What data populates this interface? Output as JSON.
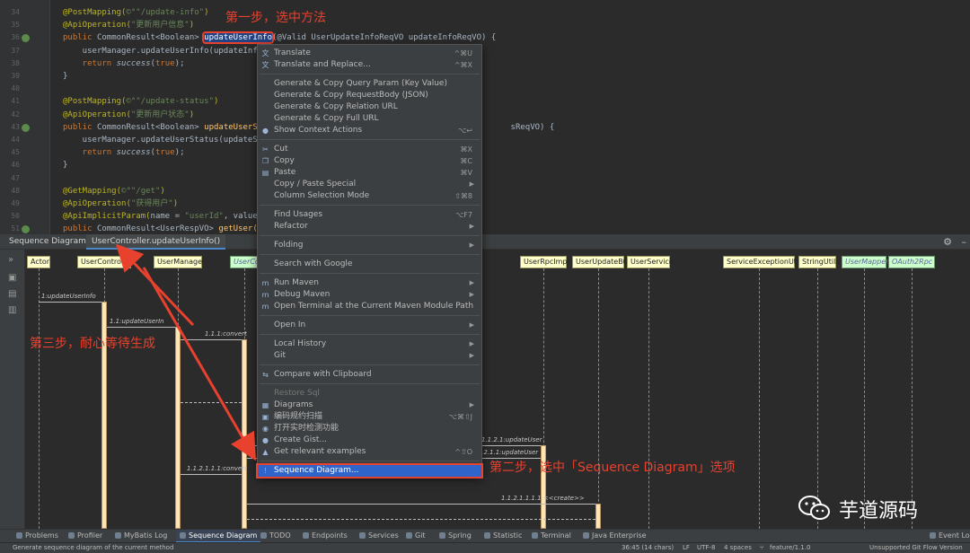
{
  "editor": {
    "lines": [
      {
        "n": "34",
        "parts": [
          [
            "ann",
            "@PostMapping("
          ],
          [
            "str",
            "©°\"/update-info\""
          ],
          [
            "ann",
            ")"
          ]
        ]
      },
      {
        "n": "35",
        "parts": [
          [
            "ann",
            "@ApiOperation("
          ],
          [
            "str",
            "\"更新用户信息\""
          ],
          [
            "ann",
            ")"
          ]
        ]
      },
      {
        "n": "36",
        "parts": [
          [
            "kw",
            "public "
          ],
          [
            "",
            "CommonResult<Boolean> "
          ],
          [
            "hl",
            "updateUserInfo"
          ],
          [
            "",
            "(@Valid UserUpdateInfoReqVO updateInfoReqVO) {"
          ]
        ]
      },
      {
        "n": "37",
        "parts": [
          [
            "",
            "    userManager.updateUserInfo(updateInf"
          ]
        ]
      },
      {
        "n": "38",
        "parts": [
          [
            "kw",
            "    return "
          ],
          [
            "it",
            "success"
          ],
          [
            "",
            "("
          ],
          [
            "kw",
            "true"
          ],
          [
            "",
            ");"
          ]
        ]
      },
      {
        "n": "39",
        "parts": [
          [
            "",
            "}"
          ]
        ]
      },
      {
        "n": "40",
        "parts": [
          [
            "",
            ""
          ]
        ]
      },
      {
        "n": "41",
        "parts": [
          [
            "ann",
            "@PostMapping("
          ],
          [
            "str",
            "©°\"/update-status\""
          ],
          [
            "ann",
            ")"
          ]
        ]
      },
      {
        "n": "42",
        "parts": [
          [
            "ann",
            "@ApiOperation("
          ],
          [
            "str",
            "\"更新用户状态\""
          ],
          [
            "ann",
            ")"
          ]
        ]
      },
      {
        "n": "43",
        "parts": [
          [
            "kw",
            "public "
          ],
          [
            "",
            "CommonResult<Boolean> "
          ],
          [
            "fn",
            "updateUserS"
          ],
          [
            "",
            "                                                    sReqVO) {"
          ]
        ]
      },
      {
        "n": "44",
        "parts": [
          [
            "",
            "    userManager.updateUserStatus(updateS"
          ]
        ]
      },
      {
        "n": "45",
        "parts": [
          [
            "kw",
            "    return "
          ],
          [
            "it",
            "success"
          ],
          [
            "",
            "("
          ],
          [
            "kw",
            "true"
          ],
          [
            "",
            ");"
          ]
        ]
      },
      {
        "n": "46",
        "parts": [
          [
            "",
            "}"
          ]
        ]
      },
      {
        "n": "47",
        "parts": [
          [
            "",
            ""
          ]
        ]
      },
      {
        "n": "48",
        "parts": [
          [
            "ann",
            "@GetMapping("
          ],
          [
            "str",
            "©°\"/get\""
          ],
          [
            "ann",
            ")"
          ]
        ]
      },
      {
        "n": "49",
        "parts": [
          [
            "ann",
            "@ApiOperation("
          ],
          [
            "str",
            "\"获得用户\""
          ],
          [
            "ann",
            ")"
          ]
        ]
      },
      {
        "n": "50",
        "parts": [
          [
            "ann",
            "@ApiImplicitParam("
          ],
          [
            "",
            "name = "
          ],
          [
            "str",
            "\"userId\""
          ],
          [
            "",
            ", value"
          ]
        ]
      },
      {
        "n": "51",
        "parts": [
          [
            "kw",
            "public "
          ],
          [
            "",
            "CommonResult<UserRespVO> "
          ],
          [
            "fn",
            "getUser("
          ]
        ]
      }
    ]
  },
  "sequence_panel": {
    "title": "Sequence Diagram:",
    "tab": "UserController.updateUserInfo()",
    "participants": [
      {
        "name": "Actor",
        "green": false
      },
      {
        "name": "UserController",
        "green": false
      },
      {
        "name": "UserManager",
        "green": false
      },
      {
        "name": "UserCo",
        "green": true
      },
      {
        "name": "UserRpcImpl",
        "green": false
      },
      {
        "name": "UserUpdateBO",
        "green": false
      },
      {
        "name": "UserService",
        "green": false
      },
      {
        "name": "ServiceExceptionUtil",
        "green": false
      },
      {
        "name": "StringUtils",
        "green": false
      },
      {
        "name": "UserMapper",
        "green": true
      },
      {
        "name": "OAuth2Rpc",
        "green": true
      }
    ],
    "messages": [
      "1:updateUserInfo",
      "1.1:updateUserIn",
      "1.1.1:convert",
      "1.1.2.1:updateUser",
      "1.1.2.1.1:updateUser",
      "1.1.2.1.1.1:convert",
      "1.1.2.1.1.1.1:<<create>>"
    ]
  },
  "context_menu": {
    "items": [
      {
        "label": "Translate",
        "shortcut": "^⌘U",
        "icon": "translate-icon"
      },
      {
        "label": "Translate and Replace...",
        "shortcut": "^⌘X",
        "icon": "translate-icon"
      },
      {
        "sep": true
      },
      {
        "label": "Generate & Copy Query Param (Key Value)"
      },
      {
        "label": "Generate & Copy RequestBody (JSON)"
      },
      {
        "label": "Generate & Copy Relation URL"
      },
      {
        "label": "Generate & Copy Full URL"
      },
      {
        "label": "Show Context Actions",
        "shortcut": "⌥↩",
        "icon": "lightbulb-icon"
      },
      {
        "sep": true
      },
      {
        "label": "Cut",
        "shortcut": "⌘X",
        "icon": "cut-icon"
      },
      {
        "label": "Copy",
        "shortcut": "⌘C",
        "icon": "copy-icon"
      },
      {
        "label": "Paste",
        "shortcut": "⌘V",
        "icon": "paste-icon"
      },
      {
        "label": "Copy / Paste Special",
        "submenu": true
      },
      {
        "label": "Column Selection Mode",
        "shortcut": "⇧⌘8"
      },
      {
        "sep": true
      },
      {
        "label": "Find Usages",
        "shortcut": "⌥F7"
      },
      {
        "label": "Refactor",
        "submenu": true
      },
      {
        "sep": true
      },
      {
        "label": "Folding",
        "submenu": true
      },
      {
        "sep": true
      },
      {
        "label": "Search with Google"
      },
      {
        "sep": true
      },
      {
        "label": "Run Maven",
        "submenu": true,
        "icon": "maven-icon"
      },
      {
        "label": "Debug Maven",
        "submenu": true,
        "icon": "maven-icon"
      },
      {
        "label": "Open Terminal at the Current Maven Module Path",
        "icon": "maven-icon"
      },
      {
        "sep": true
      },
      {
        "label": "Open In",
        "submenu": true
      },
      {
        "sep": true
      },
      {
        "label": "Local History",
        "submenu": true
      },
      {
        "label": "Git",
        "submenu": true
      },
      {
        "sep": true
      },
      {
        "label": "Compare with Clipboard",
        "icon": "compare-icon"
      },
      {
        "sep": true
      },
      {
        "label": "Restore Sql",
        "disabled": true
      },
      {
        "label": "Diagrams",
        "submenu": true,
        "icon": "diagram-icon"
      },
      {
        "label": "编码规约扫描",
        "shortcut": "⌥⌘⇧J",
        "icon": "scan-icon"
      },
      {
        "label": "打开实时检测功能",
        "icon": "realtime-icon"
      },
      {
        "label": "Create Gist...",
        "icon": "github-icon"
      },
      {
        "label": "Get relevant examples",
        "shortcut": "^⇧O",
        "icon": "examples-icon"
      },
      {
        "sep": true
      },
      {
        "label": "Sequence Diagram...",
        "selected": true,
        "icon": "sequence-icon"
      }
    ]
  },
  "annotations": {
    "step1": "第一步，选中方法",
    "step2": "第二步，选中「Sequence Diagram」选项",
    "step3": "第三步，耐心等待生成"
  },
  "toolwindows": [
    {
      "label": "Problems"
    },
    {
      "label": "Profiler"
    },
    {
      "label": "MyBatis Log"
    },
    {
      "label": "Sequence Diagram",
      "active": true
    },
    {
      "label": "TODO"
    },
    {
      "label": "Endpoints"
    },
    {
      "label": "Services"
    },
    {
      "label": "Git"
    },
    {
      "label": "Spring"
    },
    {
      "label": "Statistic"
    },
    {
      "label": "Terminal"
    },
    {
      "label": "Java Enterprise"
    },
    {
      "label": "Event Log"
    }
  ],
  "status": {
    "message": "Generate sequence diagram of the current method",
    "position": "36:45 (14 chars)",
    "line_sep": "LF",
    "encoding": "UTF-8",
    "indent": "4 spaces",
    "branch": "feature/1.1.0",
    "gitflow": "Unsupported Git Flow Version"
  },
  "watermark": {
    "text": "芋道源码"
  },
  "colors": {
    "annotation_red": "#e8412e",
    "selection_blue": "#2f65ca",
    "menu_bg": "#3c3f41"
  }
}
